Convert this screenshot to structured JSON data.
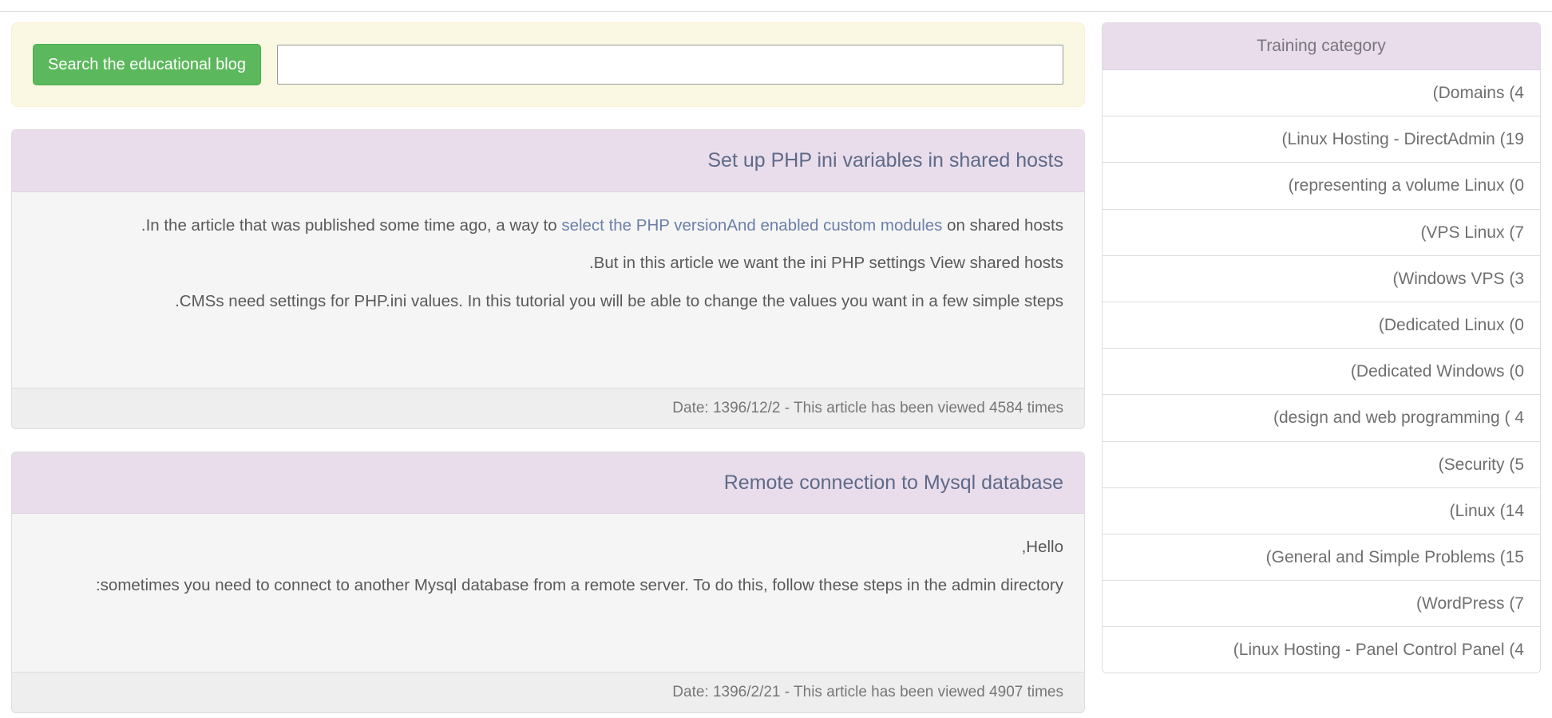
{
  "search": {
    "button_label": "Search the educational blog",
    "input_value": "",
    "placeholder": ""
  },
  "articles": [
    {
      "title": "Set up PHP ini variables in shared hosts",
      "paragraphs": [
        {
          "before": ".In the article that was published some time ago, a way to ",
          "link": "select the PHP versionAnd enabled custom modules",
          "after": " on shared hosts"
        },
        {
          "before": ".But in this article we want the ini PHP settings View shared hosts",
          "link": "",
          "after": ""
        },
        {
          "before": ".CMSs need settings for PHP.ini values. In this tutorial you will be able to change the values you want in a few simple steps",
          "link": "",
          "after": ""
        }
      ],
      "footer": "Date: 1396/12/2 - This article has been viewed 4584 times",
      "date": "1396/12/2",
      "views": "4584"
    },
    {
      "title": "Remote connection to Mysql database",
      "paragraphs": [
        {
          "before": ",Hello",
          "link": "",
          "after": ""
        },
        {
          "before": ":sometimes you need to connect to another Mysql database from a remote server. To do this, follow these steps in the admin directory",
          "link": "",
          "after": ""
        }
      ],
      "footer": "Date: 1396/2/21 - This article has been viewed 4907 times",
      "date": "1396/2/21",
      "views": "4907"
    }
  ],
  "sidebar": {
    "title": "Training category",
    "items": [
      {
        "label": "(Domains (4",
        "name": "Domains",
        "count": "4"
      },
      {
        "label": "(Linux Hosting - DirectAdmin (19",
        "name": "Linux Hosting - DirectAdmin",
        "count": "19"
      },
      {
        "label": "(representing a volume Linux (0",
        "name": "representing a volume Linux",
        "count": "0"
      },
      {
        "label": "(VPS Linux (7",
        "name": "VPS Linux",
        "count": "7"
      },
      {
        "label": "(Windows VPS (3",
        "name": "Windows VPS",
        "count": "3"
      },
      {
        "label": "(Dedicated Linux (0",
        "name": "Dedicated Linux",
        "count": "0"
      },
      {
        "label": "(Dedicated Windows (0",
        "name": "Dedicated Windows",
        "count": "0"
      },
      {
        "label": "(design and web programming ( 4",
        "name": "design and web programming",
        "count": "4"
      },
      {
        "label": "(Security (5",
        "name": "Security",
        "count": "5"
      },
      {
        "label": "(Linux (14",
        "name": "Linux",
        "count": "14"
      },
      {
        "label": "(General and Simple Problems (15",
        "name": "General and Simple Problems",
        "count": "15"
      },
      {
        "label": "(WordPress (7",
        "name": "WordPress",
        "count": "7"
      },
      {
        "label": "(Linux Hosting - Panel Control Panel (4",
        "name": "Linux Hosting - Panel Control Panel",
        "count": "4"
      }
    ]
  },
  "colors": {
    "accent_green": "#5CB85C",
    "header_lavender": "#E9DDEC",
    "search_cream": "#FAF8E3",
    "link_blue": "#6B7FA8",
    "title_slate": "#5F6A88",
    "body_gray": "#F5F5F5",
    "footer_gray": "#EEEEEE"
  }
}
